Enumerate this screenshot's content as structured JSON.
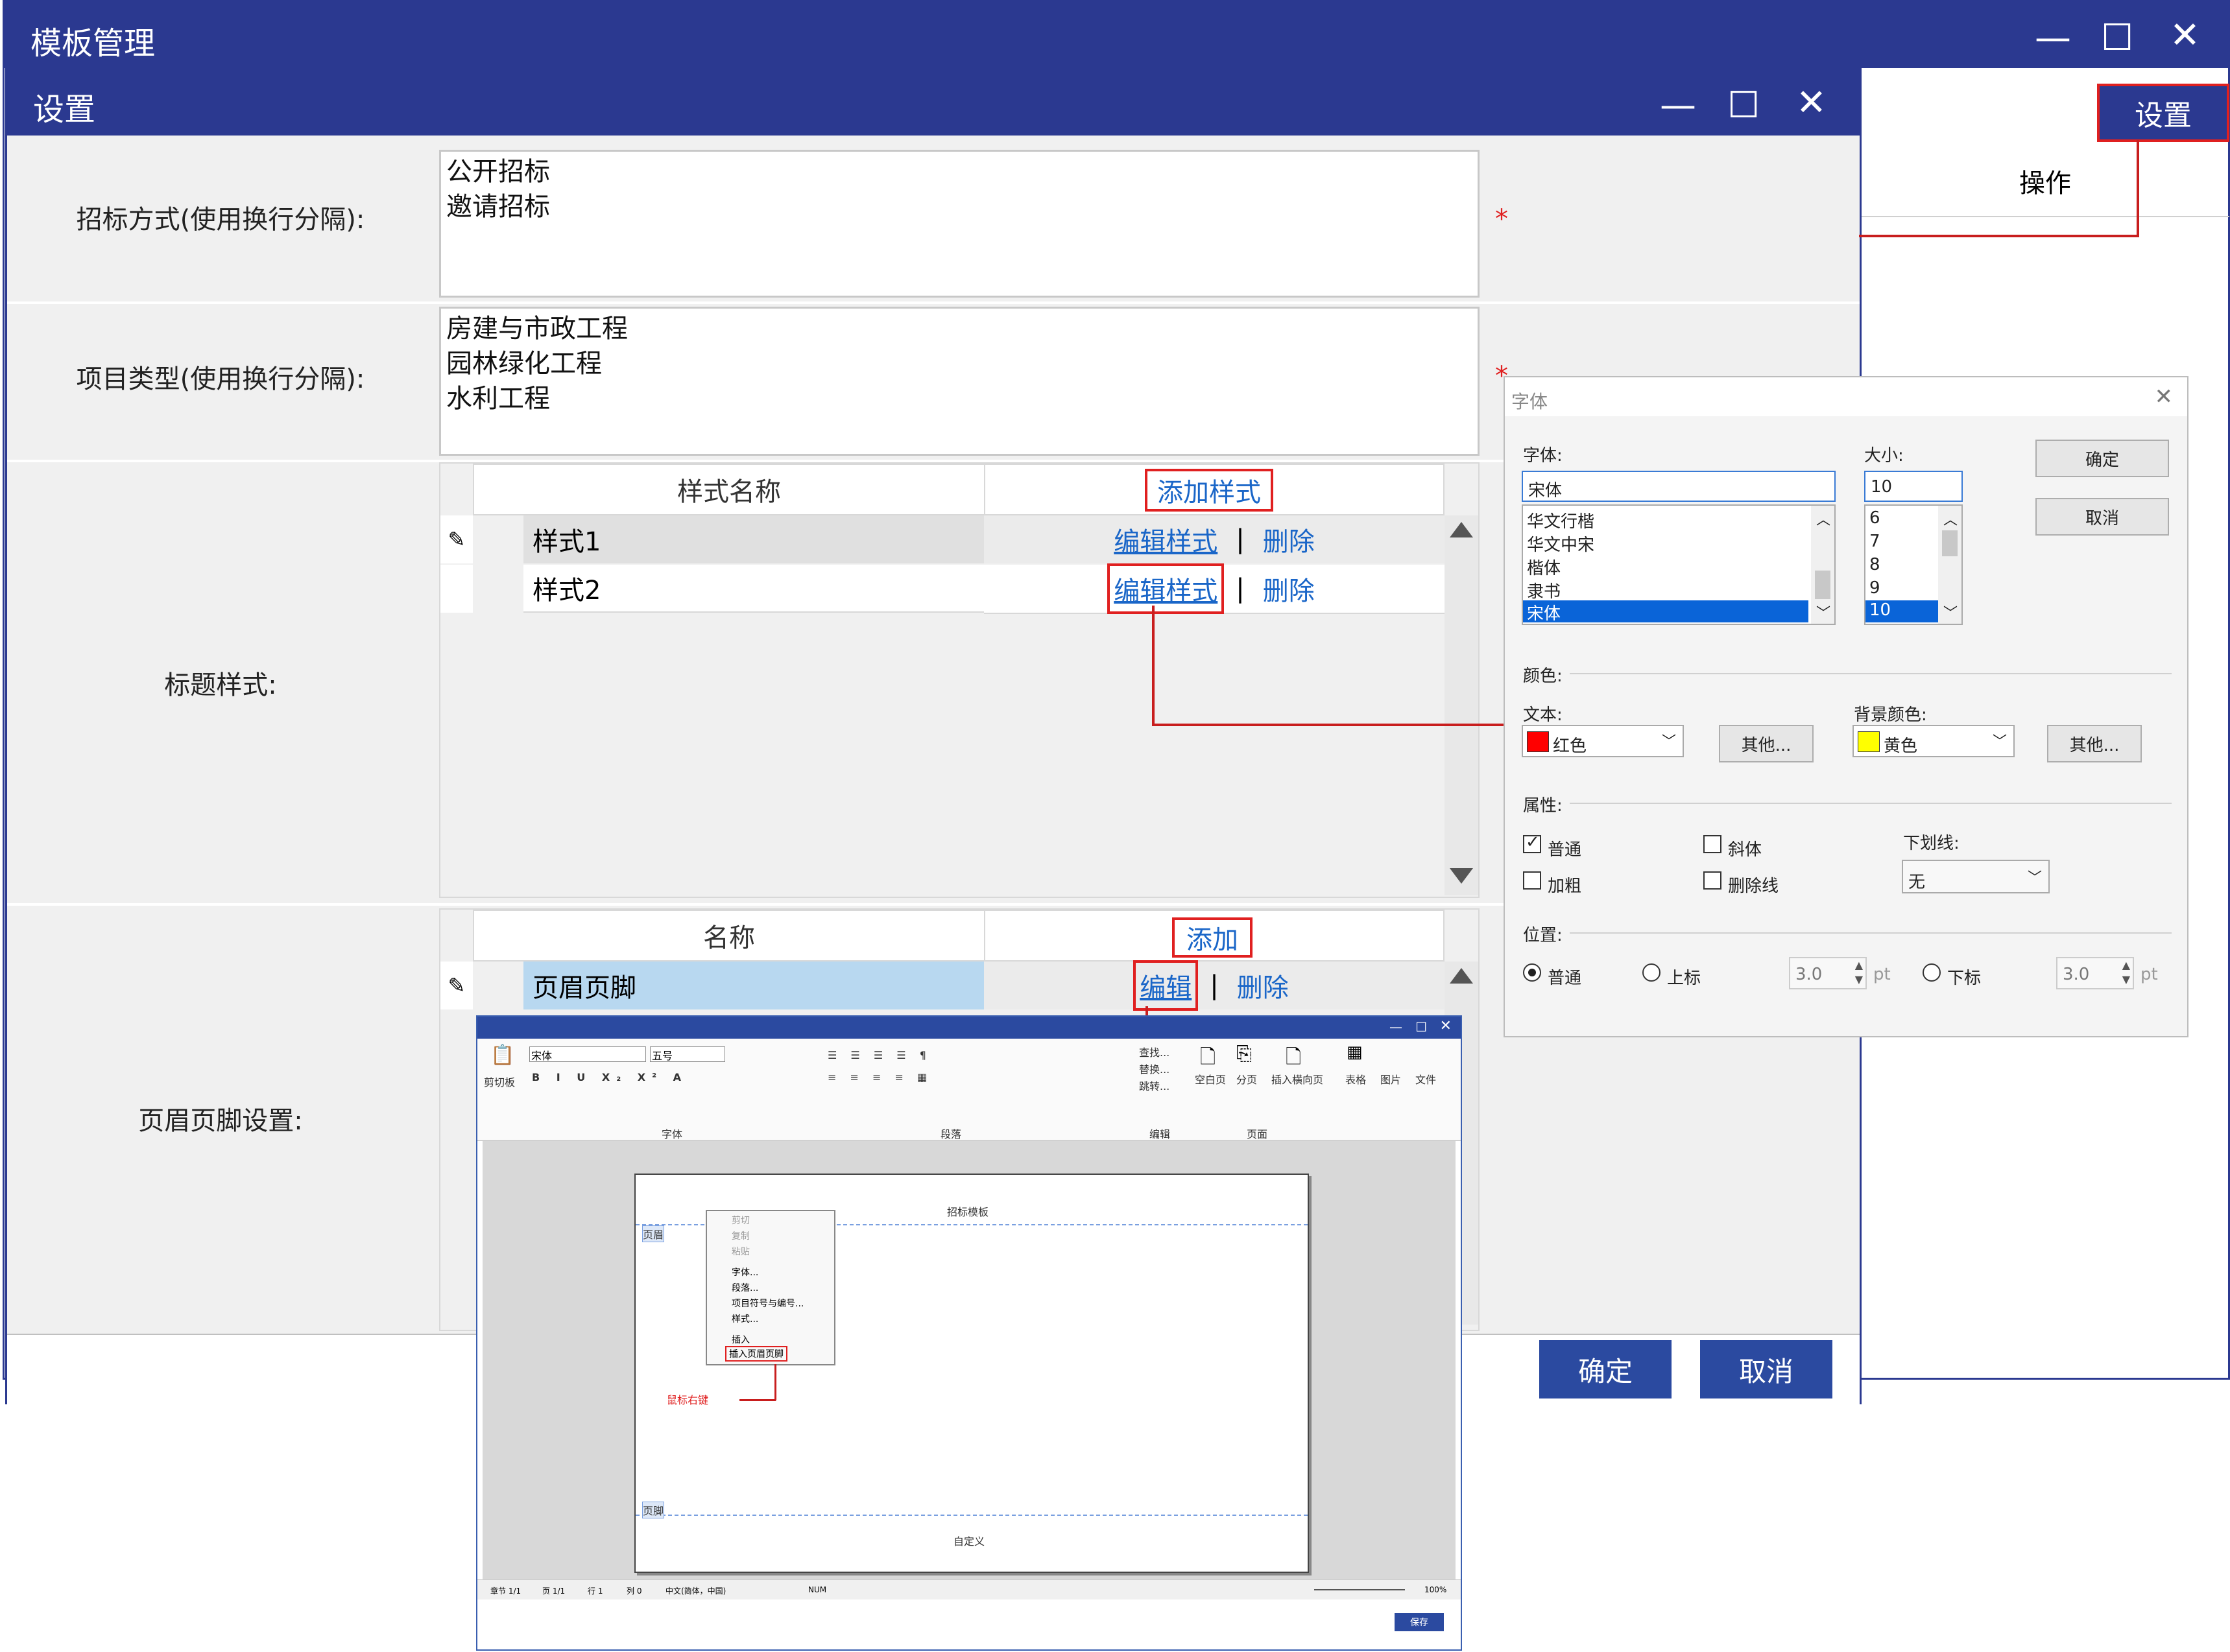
{
  "outer_window": {
    "title": "模板管理"
  },
  "side_panel": {
    "settings_button": "设置",
    "column_header": "操作"
  },
  "settings_window": {
    "title": "设置",
    "bidding_method": {
      "label": "招标方式(使用换行分隔):",
      "value": "公开招标\n邀请招标",
      "required": "*"
    },
    "project_type": {
      "label": "项目类型(使用换行分隔):",
      "value": "房建与市政工程\n园林绿化工程\n水利工程",
      "required": "*"
    },
    "title_style": {
      "label": "标题样式:",
      "col_name": "样式名称",
      "add_label": "添加样式",
      "rows": [
        {
          "name": "样式1",
          "edit": "编辑样式",
          "delete": "删除"
        },
        {
          "name": "样式2",
          "edit": "编辑样式",
          "delete": "删除"
        }
      ],
      "sep": "|"
    },
    "header_footer": {
      "label": "页眉页脚设置:",
      "col_name": "名称",
      "add_label": "添加",
      "rows": [
        {
          "name": "页眉页脚",
          "edit": "编辑",
          "delete": "删除"
        }
      ],
      "sep": "|"
    },
    "ok_button": "确定",
    "cancel_button": "取消"
  },
  "font_dialog": {
    "title": "字体",
    "font_label": "字体:",
    "font_value": "宋体",
    "font_list": [
      "华文行楷",
      "华文中宋",
      "楷体",
      "隶书",
      "宋体"
    ],
    "size_label": "大小:",
    "size_value": "10",
    "size_list": [
      "6",
      "7",
      "8",
      "9",
      "10"
    ],
    "ok": "确定",
    "cancel": "取消",
    "color_section": "颜色:",
    "text_label": "文本:",
    "text_color": "红色",
    "text_color_hex": "#ff0000",
    "bg_label": "背景颜色:",
    "bg_color": "黄色",
    "bg_color_hex": "#ffff00",
    "other": "其他...",
    "attr_section": "属性:",
    "attr_normal": "普通",
    "attr_italic": "斜体",
    "attr_bold": "加粗",
    "attr_strike": "删除线",
    "underline_label": "下划线:",
    "underline_value": "无",
    "pos_section": "位置:",
    "pos_normal": "普通",
    "pos_super": "上标",
    "pos_sub": "下标",
    "pos_value1": "3.0",
    "pos_value2": "3.0",
    "unit": "pt"
  },
  "editor": {
    "font": "宋体",
    "size": "五号",
    "group_clipboard": "剪切板",
    "group_font": "字体",
    "group_paragraph": "段落",
    "group_edit": "编辑",
    "group_page": "页面",
    "find": "查找...",
    "replace": "替换...",
    "goto": "跳转...",
    "blank_page": "空白页",
    "page_break": "分页",
    "insert_landscape": "插入横向页",
    "table": "表格",
    "picture": "图片",
    "file": "文件",
    "header_tag": "页眉",
    "footer_tag": "页脚",
    "header_text": "招标模板",
    "footer_text": "自定义",
    "context_menu": [
      "剪切",
      "复制",
      "粘贴",
      "字体...",
      "段落...",
      "项目符号与编号...",
      "样式...",
      "插入",
      "插入页眉页脚"
    ],
    "right_click_note": "鼠标右键",
    "status": [
      "章节 1/1",
      "页 1/1",
      "行 1",
      "列 0",
      "中文(简体，中国)",
      "NUM"
    ],
    "zoom": "100%",
    "save": "保存"
  }
}
